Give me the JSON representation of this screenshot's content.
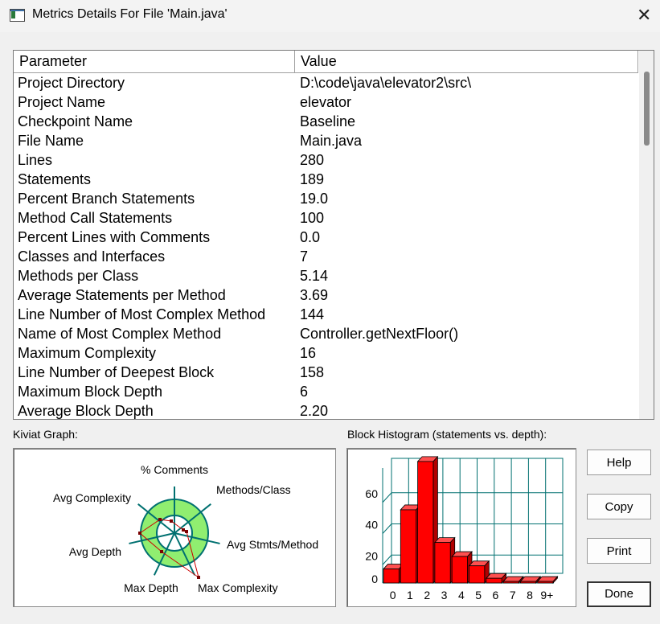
{
  "window": {
    "title": "Metrics Details For File 'Main.java'",
    "close_icon": "close-icon"
  },
  "table": {
    "headers": {
      "parameter": "Parameter",
      "value": "Value"
    },
    "rows": [
      {
        "param": "Project Directory",
        "value": "D:\\code\\java\\elevator2\\src\\"
      },
      {
        "param": "Project Name",
        "value": "elevator"
      },
      {
        "param": "Checkpoint Name",
        "value": "Baseline"
      },
      {
        "param": "File Name",
        "value": "Main.java"
      },
      {
        "param": "Lines",
        "value": "280"
      },
      {
        "param": "Statements",
        "value": "189"
      },
      {
        "param": "Percent Branch Statements",
        "value": "19.0"
      },
      {
        "param": "Method Call Statements",
        "value": "100"
      },
      {
        "param": "Percent Lines with Comments",
        "value": "0.0"
      },
      {
        "param": "Classes and Interfaces",
        "value": "7"
      },
      {
        "param": "Methods per Class",
        "value": "5.14"
      },
      {
        "param": "Average Statements per Method",
        "value": "3.69"
      },
      {
        "param": "Line Number of Most Complex Method",
        "value": "144"
      },
      {
        "param": "Name of Most Complex Method",
        "value": "Controller.getNextFloor()"
      },
      {
        "param": "Maximum Complexity",
        "value": "16"
      },
      {
        "param": "Line Number of Deepest Block",
        "value": "158"
      },
      {
        "param": "Maximum Block Depth",
        "value": "6"
      },
      {
        "param": "Average Block Depth",
        "value": "2.20"
      }
    ]
  },
  "kiviat": {
    "label": "Kiviat Graph:",
    "axes": [
      "% Comments",
      "Methods/Class",
      "Avg Stmts/Method",
      "Max Complexity",
      "Max Depth",
      "Avg Depth",
      "Avg Complexity"
    ],
    "colors": {
      "ring": "#90ee70",
      "axis": "#007070",
      "polygon": "#cc0000"
    }
  },
  "chart_data": {
    "type": "bar",
    "title": "Block Histogram (statements vs. depth):",
    "categories": [
      "0",
      "1",
      "2",
      "3",
      "4",
      "5",
      "6",
      "7",
      "8",
      "9+"
    ],
    "values": [
      9,
      47,
      78,
      26,
      17,
      11,
      3,
      1,
      1,
      1
    ],
    "ylim": [
      0,
      80
    ],
    "yticks": [
      "0",
      "20",
      "40",
      "60"
    ],
    "grid": true,
    "colors": {
      "bar": "#ff0000",
      "grid": "#007070"
    }
  },
  "buttons": {
    "help": "Help",
    "copy": "Copy",
    "print": "Print",
    "done": "Done"
  }
}
